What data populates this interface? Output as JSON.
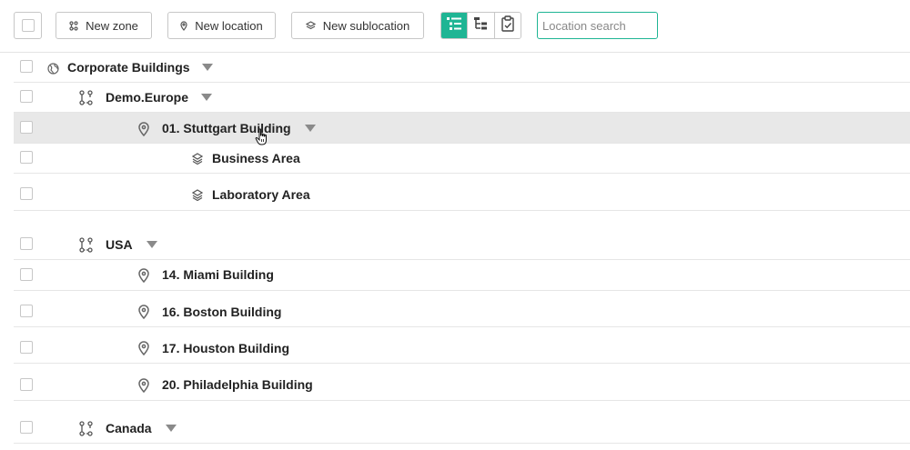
{
  "toolbar": {
    "new_zone_label": "New zone",
    "new_location_label": "New location",
    "new_sublocation_label": "New sublocation",
    "search_placeholder": "Location search",
    "active_view": "list-view",
    "accent_color": "#1fb594"
  },
  "tree": {
    "root": {
      "label": "Corporate Buildings",
      "icon": "globe-icon"
    },
    "europe": {
      "label": "Demo.Europe",
      "icon": "zone-icon"
    },
    "stuttgart": {
      "label": "01. Stuttgart Building",
      "icon": "location-pin-icon"
    },
    "business": {
      "label": "Business Area",
      "icon": "layers-icon"
    },
    "laboratory": {
      "label": "Laboratory Area",
      "icon": "layers-icon"
    },
    "usa": {
      "label": "USA",
      "icon": "zone-icon"
    },
    "miami": {
      "label": "14. Miami Building",
      "icon": "location-pin-icon"
    },
    "boston": {
      "label": "16. Boston Building",
      "icon": "location-pin-icon"
    },
    "houston": {
      "label": "17. Houston Building",
      "icon": "location-pin-icon"
    },
    "philadelphia": {
      "label": "20. Philadelphia Building",
      "icon": "location-pin-icon"
    },
    "canada": {
      "label": "Canada",
      "icon": "zone-icon"
    }
  },
  "highlight_color": "#e8e8e8"
}
